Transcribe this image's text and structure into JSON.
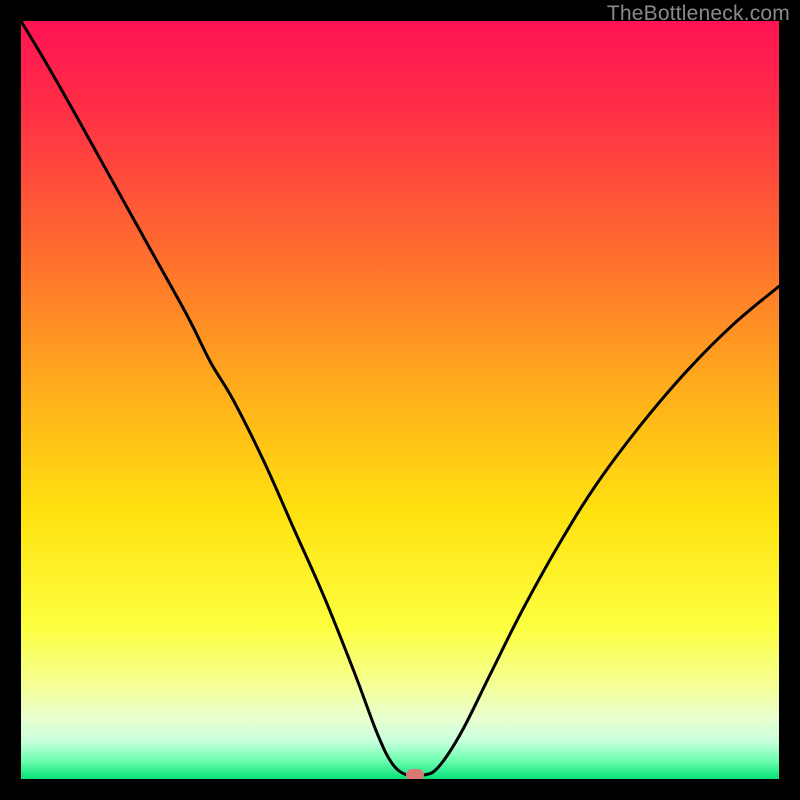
{
  "watermark": "TheBottleneck.com",
  "chart_data": {
    "type": "line",
    "title": "",
    "xlabel": "",
    "ylabel": "",
    "xlim": [
      0,
      100
    ],
    "ylim": [
      0,
      100
    ],
    "background_gradient": [
      {
        "stop": 0.0,
        "color": "#ff1353"
      },
      {
        "stop": 0.12,
        "color": "#ff2f46"
      },
      {
        "stop": 0.3,
        "color": "#ff6b2f"
      },
      {
        "stop": 0.5,
        "color": "#ffb21a"
      },
      {
        "stop": 0.65,
        "color": "#ffe210"
      },
      {
        "stop": 0.8,
        "color": "#fdff40"
      },
      {
        "stop": 0.88,
        "color": "#f4ff9a"
      },
      {
        "stop": 0.92,
        "color": "#e8ffcf"
      },
      {
        "stop": 0.95,
        "color": "#c9ffde"
      },
      {
        "stop": 0.975,
        "color": "#6fffb0"
      },
      {
        "stop": 1.0,
        "color": "#08e07a"
      }
    ],
    "series": [
      {
        "name": "bottleneck-curve",
        "stroke": "#000000",
        "stroke_width": 3,
        "x": [
          0.0,
          3.0,
          7.0,
          12.0,
          17.0,
          22.0,
          25.0,
          28.0,
          32.0,
          36.0,
          40.0,
          44.0,
          47.0,
          49.0,
          51.0,
          53.0,
          55.0,
          58.0,
          62.0,
          66.0,
          71.0,
          76.0,
          82.0,
          88.0,
          94.0,
          100.0
        ],
        "y": [
          100.0,
          95.0,
          88.0,
          79.0,
          70.0,
          61.0,
          55.0,
          50.0,
          42.0,
          33.0,
          24.0,
          14.0,
          6.0,
          2.0,
          0.5,
          0.5,
          1.5,
          6.0,
          14.0,
          22.0,
          31.0,
          39.0,
          47.0,
          54.0,
          60.0,
          65.0
        ]
      }
    ],
    "marker": {
      "x": 52.0,
      "y": 0.5,
      "color": "#d97a77"
    }
  }
}
